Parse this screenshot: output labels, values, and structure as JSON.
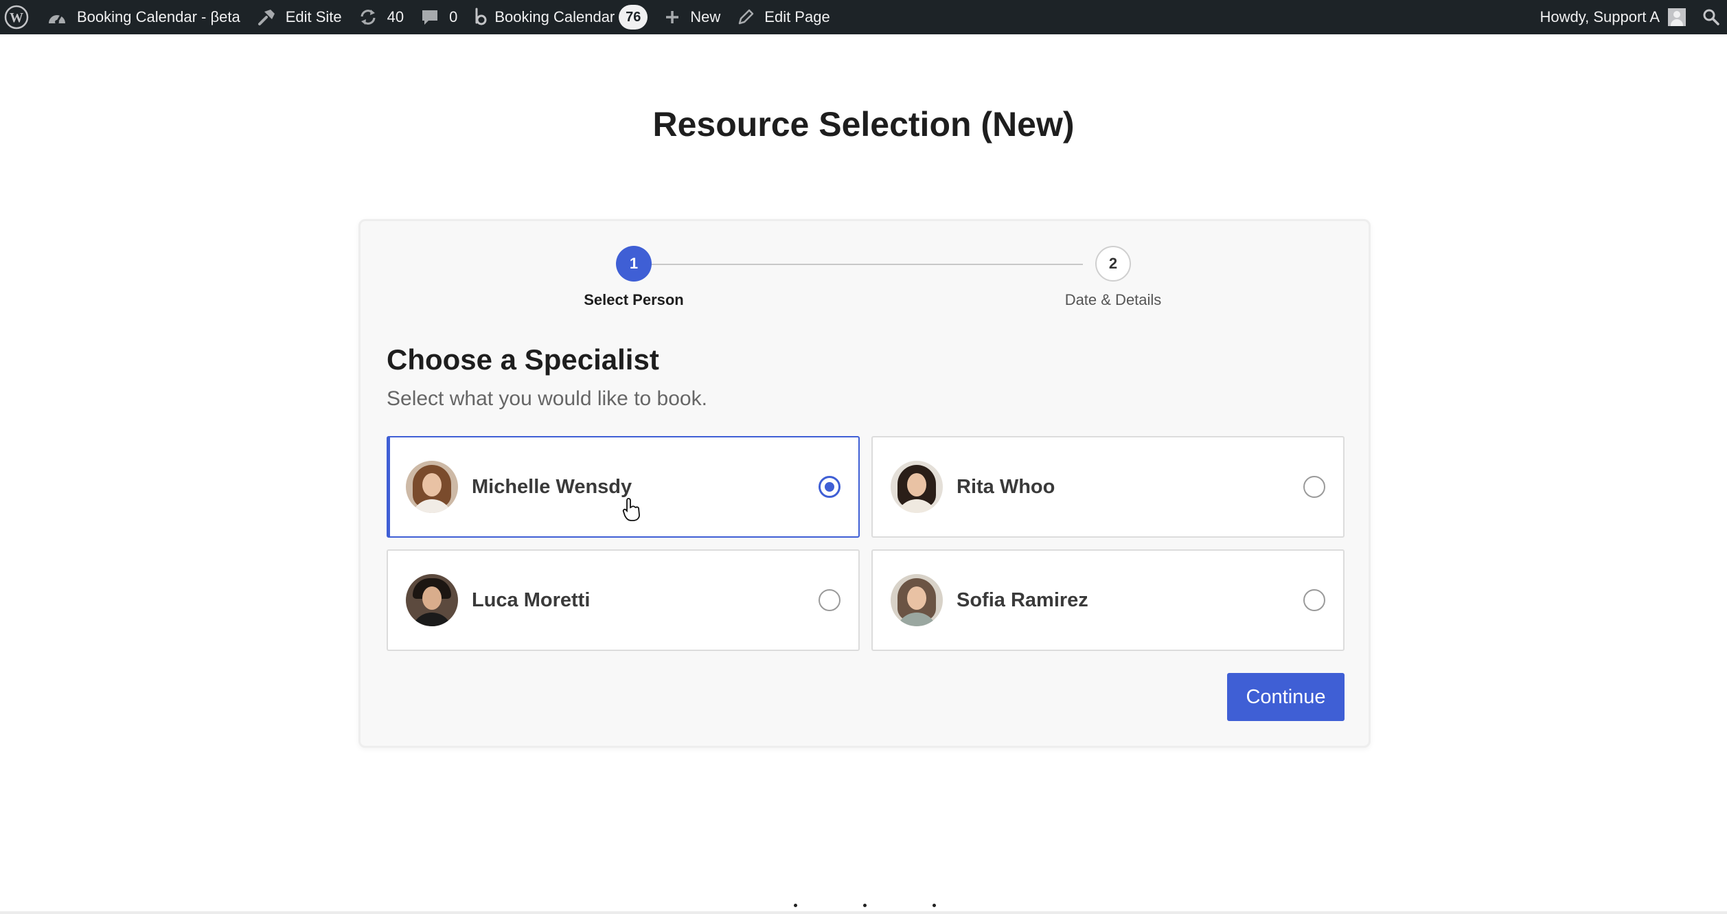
{
  "admin_bar": {
    "site_name": "Booking Calendar - βeta",
    "edit_site": "Edit Site",
    "updates_count": "40",
    "comments_count": "0",
    "plugin_name": "Booking Calendar",
    "plugin_badge": "76",
    "new_label": "New",
    "edit_page": "Edit Page",
    "howdy": "Howdy, Support A"
  },
  "page": {
    "title": "Resource Selection (New)"
  },
  "stepper": {
    "steps": [
      {
        "number": "1",
        "label": "Select Person",
        "state": "active"
      },
      {
        "number": "2",
        "label": "Date & Details",
        "state": "inactive"
      }
    ]
  },
  "section": {
    "heading": "Choose a Specialist",
    "subheading": "Select what you would like to book."
  },
  "specialists": [
    {
      "name": "Michelle Wensdy",
      "selected": true
    },
    {
      "name": "Rita Whoo",
      "selected": false
    },
    {
      "name": "Luca Moretti",
      "selected": false
    },
    {
      "name": "Sofia Ramirez",
      "selected": false
    }
  ],
  "continue_label": "Continue",
  "colors": {
    "accent": "#3f5fd5",
    "admin_bar_bg": "#1d2327",
    "card_bg": "#f8f8f8"
  },
  "icons": [
    "wordpress-icon",
    "dashboard-icon",
    "edit-site-icon",
    "updates-icon",
    "comments-icon",
    "booking-calendar-icon",
    "plus-icon",
    "pencil-icon",
    "search-icon"
  ]
}
